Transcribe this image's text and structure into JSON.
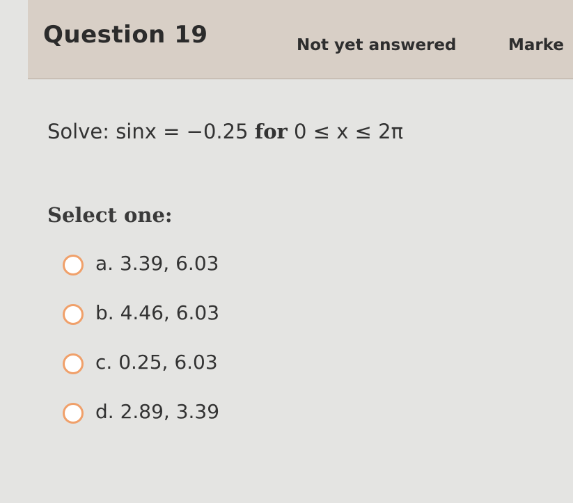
{
  "header": {
    "question_title": "Question 19",
    "state": "Not yet answered",
    "mark": "Marke"
  },
  "question": {
    "prefix": "Solve: sinx = −0.25 ",
    "for_word": "for",
    "suffix": " 0 ≤ x ≤ 2π"
  },
  "prompt": "Select one:",
  "options": [
    {
      "label": "a. 3.39, 6.03",
      "selected": false
    },
    {
      "label": "b. 4.46, 6.03",
      "selected": false
    },
    {
      "label": "c. 0.25, 6.03",
      "selected": false
    },
    {
      "label": "d. 2.89, 3.39",
      "selected": false
    }
  ],
  "colors": {
    "header_bg": "#d8cfc6",
    "page_bg": "#e4e4e2",
    "radio_border": "#f0a06a"
  }
}
